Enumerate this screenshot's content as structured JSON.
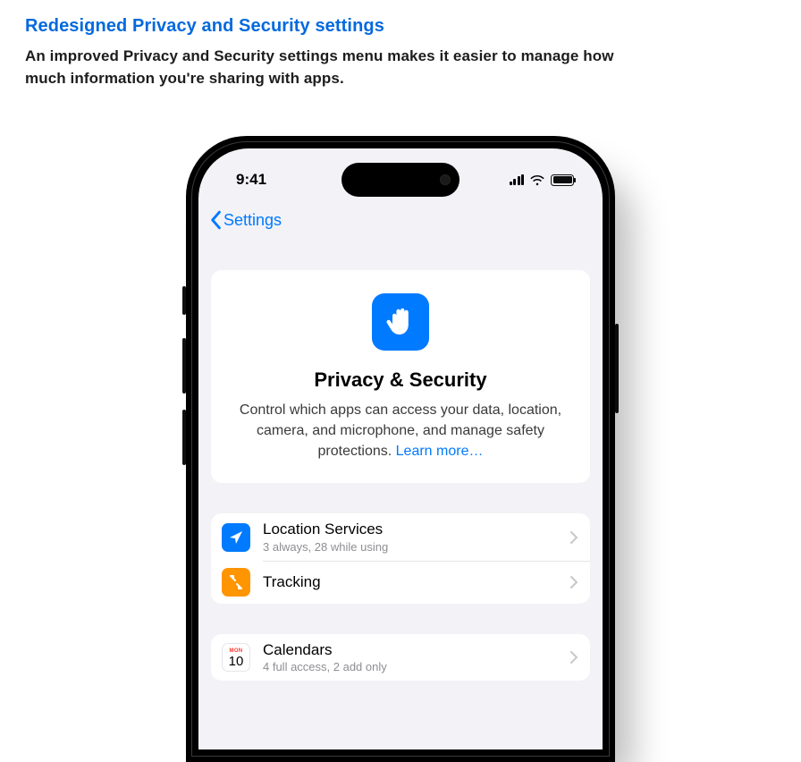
{
  "header": {
    "title": "Redesigned Privacy and Security settings",
    "description": "An improved Privacy and Security settings menu makes it easier to manage how much information you're sharing with apps."
  },
  "statusBar": {
    "time": "9:41"
  },
  "nav": {
    "backLabel": "Settings"
  },
  "hero": {
    "title": "Privacy & Security",
    "body": "Control which apps can access your data, location, camera, and microphone, and manage safety protections. ",
    "learnMore": "Learn more…"
  },
  "group1": {
    "row0": {
      "title": "Location Services",
      "sub": "3 always, 28 while using"
    },
    "row1": {
      "title": "Tracking"
    }
  },
  "group2": {
    "row0": {
      "title": "Calendars",
      "sub": "4 full access, 2 add only",
      "calMonth": "MON",
      "calDay": "10"
    }
  }
}
